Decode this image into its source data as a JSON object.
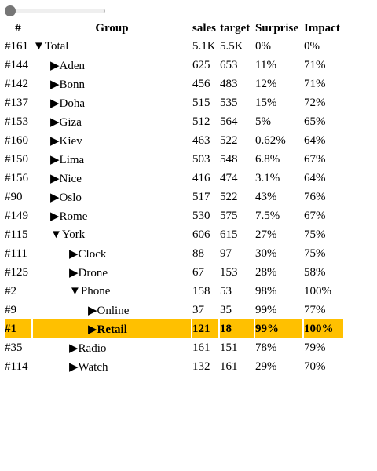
{
  "slider": {
    "value": 0
  },
  "columns": {
    "id": "#",
    "group": "Group",
    "sales": "sales",
    "target": "target",
    "surprise": "Surprise",
    "impact": "Impact"
  },
  "rows": [
    {
      "id": "#161",
      "indent": 0,
      "expanded": true,
      "label": "Total",
      "sales": "5.1K",
      "target": "5.5K",
      "surprise": "0%",
      "impact": "0%"
    },
    {
      "id": "#144",
      "indent": 1,
      "expanded": false,
      "label": "Aden",
      "sales": "625",
      "target": "653",
      "surprise": "11%",
      "impact": "71%"
    },
    {
      "id": "#142",
      "indent": 1,
      "expanded": false,
      "label": "Bonn",
      "sales": "456",
      "target": "483",
      "surprise": "12%",
      "impact": "71%"
    },
    {
      "id": "#137",
      "indent": 1,
      "expanded": false,
      "label": "Doha",
      "sales": "515",
      "target": "535",
      "surprise": "15%",
      "impact": "72%"
    },
    {
      "id": "#153",
      "indent": 1,
      "expanded": false,
      "label": "Giza",
      "sales": "512",
      "target": "564",
      "surprise": "5%",
      "impact": "65%"
    },
    {
      "id": "#160",
      "indent": 1,
      "expanded": false,
      "label": "Kiev",
      "sales": "463",
      "target": "522",
      "surprise": "0.62%",
      "impact": "64%"
    },
    {
      "id": "#150",
      "indent": 1,
      "expanded": false,
      "label": "Lima",
      "sales": "503",
      "target": "548",
      "surprise": "6.8%",
      "impact": "67%"
    },
    {
      "id": "#156",
      "indent": 1,
      "expanded": false,
      "label": "Nice",
      "sales": "416",
      "target": "474",
      "surprise": "3.1%",
      "impact": "64%"
    },
    {
      "id": "#90",
      "indent": 1,
      "expanded": false,
      "label": "Oslo",
      "sales": "517",
      "target": "522",
      "surprise": "43%",
      "impact": "76%"
    },
    {
      "id": "#149",
      "indent": 1,
      "expanded": false,
      "label": "Rome",
      "sales": "530",
      "target": "575",
      "surprise": "7.5%",
      "impact": "67%"
    },
    {
      "id": "#115",
      "indent": 1,
      "expanded": true,
      "label": "York",
      "sales": "606",
      "target": "615",
      "surprise": "27%",
      "impact": "75%"
    },
    {
      "id": "#111",
      "indent": 2,
      "expanded": false,
      "label": "Clock",
      "sales": "88",
      "target": "97",
      "surprise": "30%",
      "impact": "75%"
    },
    {
      "id": "#125",
      "indent": 2,
      "expanded": false,
      "label": "Drone",
      "sales": "67",
      "target": "153",
      "surprise": "28%",
      "impact": "58%"
    },
    {
      "id": "#2",
      "indent": 2,
      "expanded": true,
      "label": "Phone",
      "sales": "158",
      "target": "53",
      "surprise": "98%",
      "impact": "100%"
    },
    {
      "id": "#9",
      "indent": 3,
      "expanded": false,
      "label": "Online",
      "sales": "37",
      "target": "35",
      "surprise": "99%",
      "impact": "77%"
    },
    {
      "id": "#1",
      "indent": 3,
      "expanded": false,
      "label": "Retail",
      "sales": "121",
      "target": "18",
      "surprise": "99%",
      "impact": "100%",
      "highlight": true
    },
    {
      "id": "#35",
      "indent": 2,
      "expanded": false,
      "label": "Radio",
      "sales": "161",
      "target": "151",
      "surprise": "78%",
      "impact": "79%"
    },
    {
      "id": "#114",
      "indent": 2,
      "expanded": false,
      "label": "Watch",
      "sales": "132",
      "target": "161",
      "surprise": "29%",
      "impact": "70%"
    }
  ],
  "colors": {
    "highlight": "#ffc000"
  },
  "icons": {
    "collapsed": "triangle-right-icon",
    "expanded": "triangle-down-icon"
  }
}
